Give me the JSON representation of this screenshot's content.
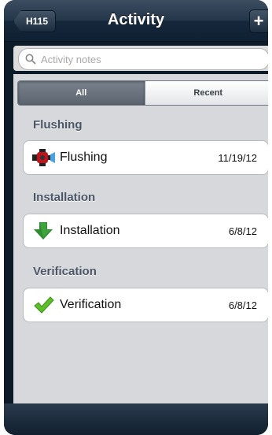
{
  "nav": {
    "back_label": "H115",
    "title": "Activity",
    "add_label": "+"
  },
  "search": {
    "placeholder": "Activity notes"
  },
  "segments": [
    {
      "label": "All",
      "selected": true
    },
    {
      "label": "Recent",
      "selected": false
    }
  ],
  "sections": [
    {
      "header": "Flushing",
      "item": {
        "label": "Flushing",
        "date": "11/19/12",
        "icon": "flushing-valve-icon"
      }
    },
    {
      "header": "Installation",
      "item": {
        "label": "Installation",
        "date": "6/8/12",
        "icon": "green-down-arrow-icon"
      }
    },
    {
      "header": "Verification",
      "item": {
        "label": "Verification",
        "date": "6/8/12",
        "icon": "green-checkmark-icon"
      }
    }
  ],
  "colors": {
    "navbar": "#1c2d40",
    "background": "#d6d8dc",
    "section_header": "#4a5566",
    "arrow_green": "#2e8b2e",
    "check_green": "#5cbf2a"
  }
}
